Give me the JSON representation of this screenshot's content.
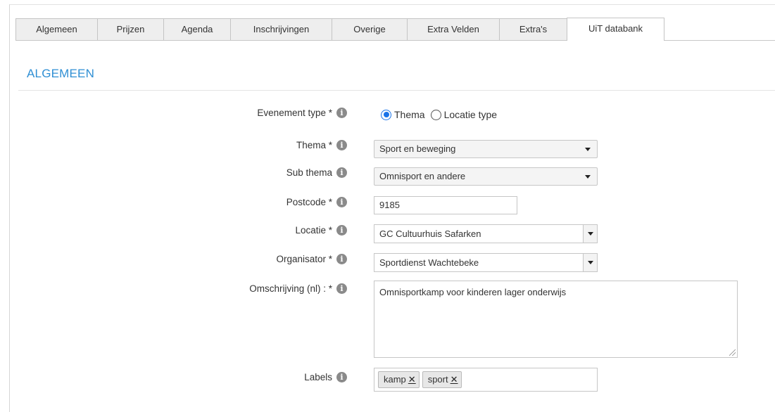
{
  "tabs": [
    {
      "label": "Algemeen",
      "active": false
    },
    {
      "label": "Prijzen",
      "active": false
    },
    {
      "label": "Agenda",
      "active": false
    },
    {
      "label": "Inschrijvingen",
      "active": false
    },
    {
      "label": "Overige",
      "active": false
    },
    {
      "label": "Extra Velden",
      "active": false
    },
    {
      "label": "Extra's",
      "active": false
    },
    {
      "label": "UiT databank",
      "active": true
    }
  ],
  "section": {
    "title": "ALGEMEEN"
  },
  "form": {
    "event_type": {
      "label": "Evenement type *",
      "options": [
        {
          "label": "Thema",
          "checked": true
        },
        {
          "label": "Locatie type",
          "checked": false
        }
      ]
    },
    "thema": {
      "label": "Thema *",
      "value": "Sport en beweging"
    },
    "sub_thema": {
      "label": "Sub thema",
      "value": "Omnisport en andere"
    },
    "postcode": {
      "label": "Postcode *",
      "value": "9185"
    },
    "locatie": {
      "label": "Locatie *",
      "value": "GC Cultuurhuis Safarken"
    },
    "organisator": {
      "label": "Organisator *",
      "value": "Sportdienst Wachtebeke"
    },
    "omschrijving": {
      "label": "Omschrijving (nl) : *",
      "value": "Omnisportkamp voor kinderen lager onderwijs"
    },
    "labels": {
      "label": "Labels",
      "tags": [
        "kamp",
        "sport"
      ],
      "remove_glyph": "✕"
    }
  },
  "icons": {
    "info": "info-circle-icon",
    "info_glyph": "i"
  },
  "colors": {
    "accent": "#2f8fd4",
    "radio": "#1a73e8"
  }
}
